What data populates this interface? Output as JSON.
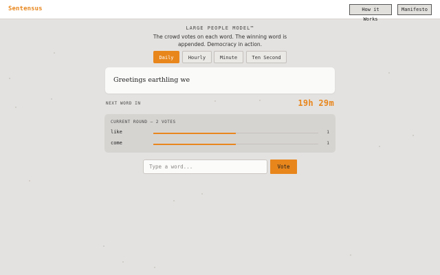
{
  "colors": {
    "accent": "#e8861c",
    "background": "#e4e2e0",
    "card": "#fafaf9",
    "panel": "#d6d4d1"
  },
  "header": {
    "brand": "Sentensus",
    "nav": [
      {
        "label": "How it Works"
      },
      {
        "label": "Manifesto"
      }
    ]
  },
  "intro": {
    "title": "LARGE PEOPLE MODEL™",
    "subtitle": "The crowd votes on each word. The winning word is appended. Democracy in action."
  },
  "tabs": [
    {
      "label": "Daily",
      "active": true
    },
    {
      "label": "Hourly",
      "active": false
    },
    {
      "label": "Minute",
      "active": false
    },
    {
      "label": "Ten Second",
      "active": false
    }
  ],
  "sentence": {
    "text": "Greetings earthling we"
  },
  "countdown": {
    "label": "NEXT WORD IN",
    "value": "19h 29m"
  },
  "round": {
    "label": "CURRENT ROUND — 2 VOTES",
    "options": [
      {
        "word": "like",
        "count": "1",
        "fraction": 0.5
      },
      {
        "word": "come",
        "count": "1",
        "fraction": 0.5
      }
    ]
  },
  "input": {
    "placeholder": "Type a word...",
    "value": ""
  },
  "vote_button": {
    "label": "Vote"
  }
}
